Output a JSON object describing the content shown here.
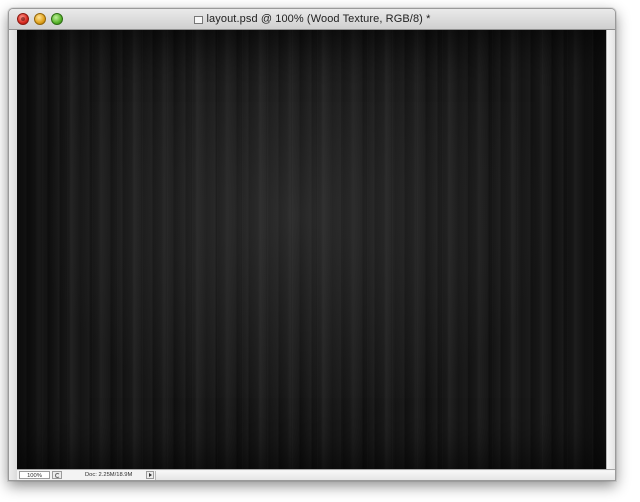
{
  "window": {
    "title": "layout.psd @ 100% (Wood Texture, RGB/8) *"
  },
  "statusbar": {
    "zoom": "100%",
    "doc_size": "Doc: 2.25M/18.9M"
  },
  "icons": {
    "close": "close-icon",
    "minimize": "minimize-icon",
    "zoom": "maximize-icon",
    "document": "document-icon",
    "refresh": "refresh-icon",
    "arrow": "chevron-right-icon"
  },
  "colors": {
    "canvas": "#151515",
    "titlebar": "#d9d9d9",
    "close": "#d8291f",
    "minimize": "#e0a21c",
    "maximize": "#57b42a"
  }
}
